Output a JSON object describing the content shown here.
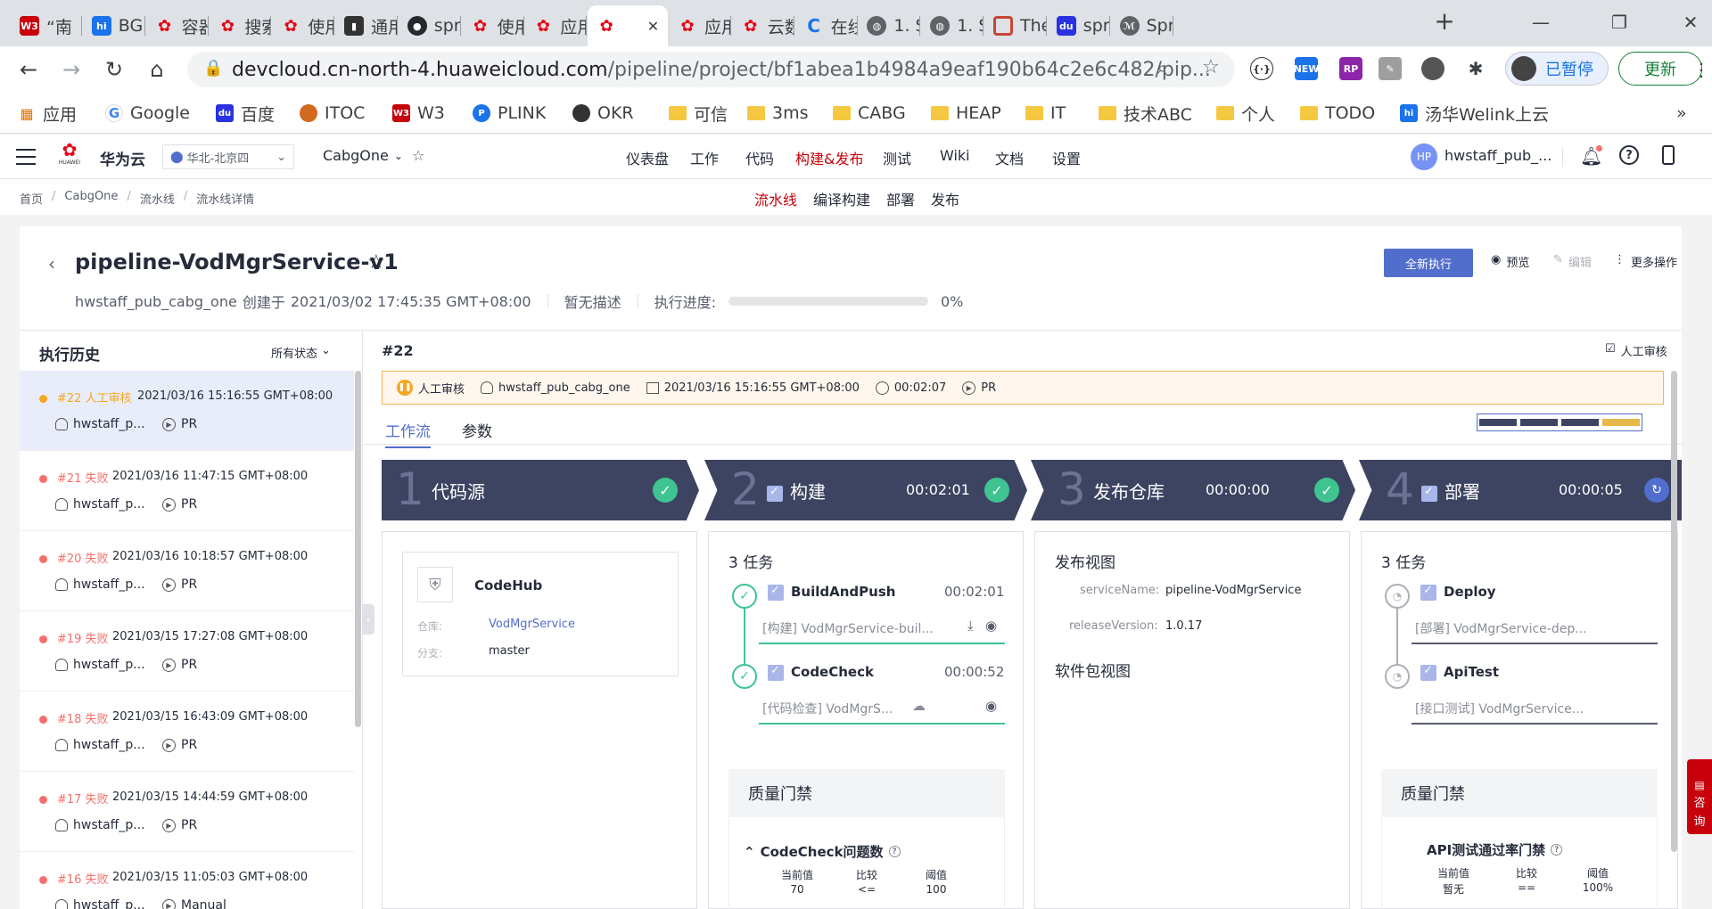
{
  "browser": {
    "tabs": [
      {
        "label": "“南",
        "icon": "w3"
      },
      {
        "label": "BG",
        "icon": "hi"
      },
      {
        "label": "容器",
        "icon": "huawei"
      },
      {
        "label": "搜索",
        "icon": "huawei"
      },
      {
        "label": "使用",
        "icon": "huawei"
      },
      {
        "label": "通用",
        "icon": "doc"
      },
      {
        "label": "spr",
        "icon": "github"
      },
      {
        "label": "使用",
        "icon": "huawei"
      },
      {
        "label": "应用",
        "icon": "huawei"
      },
      {
        "label": "",
        "icon": "huawei",
        "active": true
      },
      {
        "label": "应用",
        "icon": "huawei"
      },
      {
        "label": "云数",
        "icon": "huawei"
      },
      {
        "label": "在线",
        "icon": "c"
      },
      {
        "label": "1. S",
        "icon": "globe"
      },
      {
        "label": "1. S",
        "icon": "globe"
      },
      {
        "label": "The",
        "icon": "oracle"
      },
      {
        "label": "spr",
        "icon": "baidu"
      },
      {
        "label": "Spr",
        "icon": "spr"
      }
    ],
    "url_host": "devcloud.cn-north-4.huaweicloud.com",
    "url_path": "/pipeline/project/bf1abea1b4984a9eaf190b64c2e6c482/pip...",
    "paused_label": "已暂停",
    "update_label": "更新",
    "bookmarks": [
      {
        "label": "应用",
        "icon": "apps"
      },
      {
        "label": "Google",
        "icon": "google"
      },
      {
        "label": "百度",
        "icon": "baidu"
      },
      {
        "label": "ITOC",
        "icon": "itoc"
      },
      {
        "label": "W3",
        "icon": "w3"
      },
      {
        "label": "PLINK",
        "icon": "plink"
      },
      {
        "label": "OKR",
        "icon": "okr"
      },
      {
        "label": "可信",
        "icon": "folder"
      },
      {
        "label": "3ms",
        "icon": "folder"
      },
      {
        "label": "CABG",
        "icon": "folder"
      },
      {
        "label": "HEAP",
        "icon": "folder"
      },
      {
        "label": "IT",
        "icon": "folder"
      },
      {
        "label": "技术ABC",
        "icon": "folder"
      },
      {
        "label": "个人",
        "icon": "folder"
      },
      {
        "label": "TODO",
        "icon": "folder"
      },
      {
        "label": "汤华Welink上云",
        "icon": "hi"
      }
    ],
    "more_bookmarks": "»"
  },
  "app": {
    "brand": "华为云",
    "huawei_logo_text": "HUAWEI",
    "region": "华北-北京四",
    "project": "CabgOne",
    "nav": [
      "仪表盘",
      "工作",
      "代码",
      "构建&发布",
      "测试",
      "Wiki",
      "文档",
      "设置"
    ],
    "nav_active": 3,
    "user_initials": "HP",
    "user_name": "hwstaff_pub_...",
    "breadcrumb": [
      "首页",
      "CabgOne",
      "流水线",
      "流水线详情"
    ],
    "breadcrumb_sep": "/",
    "subnav": [
      "流水线",
      "编译构建",
      "部署",
      "发布"
    ],
    "subnav_active": 0
  },
  "pipeline": {
    "name": "pipeline-VodMgrService-v1",
    "creator": "hwstaff_pub_cabg_one",
    "created_prefix": "创建于",
    "created_at": "2021/03/02 17:45:35 GMT+08:00",
    "description": "暂无描述",
    "progress_label": "执行进度:",
    "progress_value": 0,
    "progress_text": "0%",
    "actions": {
      "run": "全新执行",
      "preview": "预览",
      "edit": "编辑",
      "more": "更多操作"
    }
  },
  "history": {
    "title": "执行历史",
    "filter": "所有状态",
    "items": [
      {
        "num": "#22",
        "status": "人工审核",
        "time": "2021/03/16 15:16:55 GMT+08:00",
        "user": "hwstaff_p...",
        "trigger": "PR",
        "color": "#f5a623"
      },
      {
        "num": "#21",
        "status": "失败",
        "time": "2021/03/16 11:47:15 GMT+08:00",
        "user": "hwstaff_p...",
        "trigger": "PR",
        "color": "#f66f6a"
      },
      {
        "num": "#20",
        "status": "失败",
        "time": "2021/03/16 10:18:57 GMT+08:00",
        "user": "hwstaff_p...",
        "trigger": "PR",
        "color": "#f66f6a"
      },
      {
        "num": "#19",
        "status": "失败",
        "time": "2021/03/15 17:27:08 GMT+08:00",
        "user": "hwstaff_p...",
        "trigger": "PR",
        "color": "#f66f6a"
      },
      {
        "num": "#18",
        "status": "失败",
        "time": "2021/03/15 16:43:09 GMT+08:00",
        "user": "hwstaff_p...",
        "trigger": "PR",
        "color": "#f66f6a"
      },
      {
        "num": "#17",
        "status": "失败",
        "time": "2021/03/15 14:44:59 GMT+08:00",
        "user": "hwstaff_p...",
        "trigger": "PR",
        "color": "#f66f6a"
      },
      {
        "num": "#16",
        "status": "失败",
        "time": "2021/03/15 11:05:03 GMT+08:00",
        "user": "hwstaff_p...",
        "trigger": "Manual",
        "color": "#f66f6a"
      }
    ]
  },
  "run": {
    "id": "#22",
    "manual_review": "人工审核",
    "status": "人工审核",
    "user": "hwstaff_pub_cabg_one",
    "time": "2021/03/16 15:16:55 GMT+08:00",
    "duration": "00:02:07",
    "trigger": "PR",
    "tabs": [
      "工作流",
      "参数"
    ],
    "tab_active": 0
  },
  "stages": [
    {
      "num": "1",
      "name": "代码源",
      "time": "",
      "state": "success"
    },
    {
      "num": "2",
      "name": "构建",
      "time": "00:02:01",
      "state": "success"
    },
    {
      "num": "3",
      "name": "发布仓库",
      "time": "00:00:00",
      "state": "success"
    },
    {
      "num": "4",
      "name": "部署",
      "time": "00:00:05",
      "state": "running"
    }
  ],
  "source": {
    "title": "CodeHub",
    "repo_label": "仓库:",
    "repo": "VodMgrService",
    "branch_label": "分支:",
    "branch": "master"
  },
  "build": {
    "count": "3 任务",
    "tasks": [
      {
        "name": "BuildAndPush",
        "time": "00:02:01",
        "sub": "[构建] VodMgrService-buil..."
      },
      {
        "name": "CodeCheck",
        "time": "00:00:52",
        "sub": "[代码检查] VodMgrS..."
      }
    ],
    "gate_title": "质量门禁",
    "gate_item": "CodeCheck问题数",
    "gate_cols": [
      "当前值",
      "比较",
      "阈值"
    ],
    "gate_vals": [
      "70",
      "<=",
      "100"
    ]
  },
  "release": {
    "title": "发布视图",
    "rows": [
      {
        "k": "serviceName:",
        "v": "pipeline-VodMgrService"
      },
      {
        "k": "releaseVersion:",
        "v": "1.0.17"
      }
    ],
    "pkg_title": "软件包视图"
  },
  "deploy": {
    "count": "3 任务",
    "tasks": [
      {
        "name": "Deploy",
        "sub": "[部署] VodMgrService-dep..."
      },
      {
        "name": "ApiTest",
        "sub": "[接口测试] VodMgrService..."
      }
    ],
    "gate_title": "质量门禁",
    "gate_item": "API测试通过率门禁",
    "gate_cols": [
      "当前值",
      "比较",
      "阈值"
    ],
    "gate_vals": [
      "暂无",
      "==",
      "100%"
    ]
  },
  "consult": [
    "咨",
    "询"
  ]
}
